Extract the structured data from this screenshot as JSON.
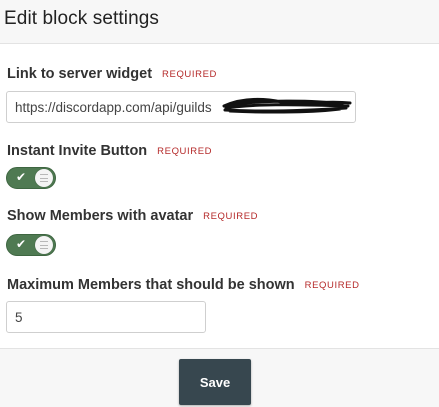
{
  "dialog": {
    "title": "Edit block settings"
  },
  "fields": {
    "link": {
      "label": "Link to server widget",
      "required": "REQUIRED",
      "value": "https://discordapp.com/api/guilds"
    },
    "invite": {
      "label": "Instant Invite Button",
      "required": "REQUIRED",
      "enabled": true,
      "check_icon": "check-icon"
    },
    "avatars": {
      "label": "Show Members with avatar",
      "required": "REQUIRED",
      "enabled": true,
      "check_icon": "check-icon"
    },
    "max_members": {
      "label": "Maximum Members that should be shown",
      "required": "REQUIRED",
      "value": "5"
    }
  },
  "footer": {
    "save_label": "Save"
  },
  "colors": {
    "toggle_on": "#4f7a52",
    "required_text": "#b52a2a",
    "save_button": "#37474f"
  }
}
